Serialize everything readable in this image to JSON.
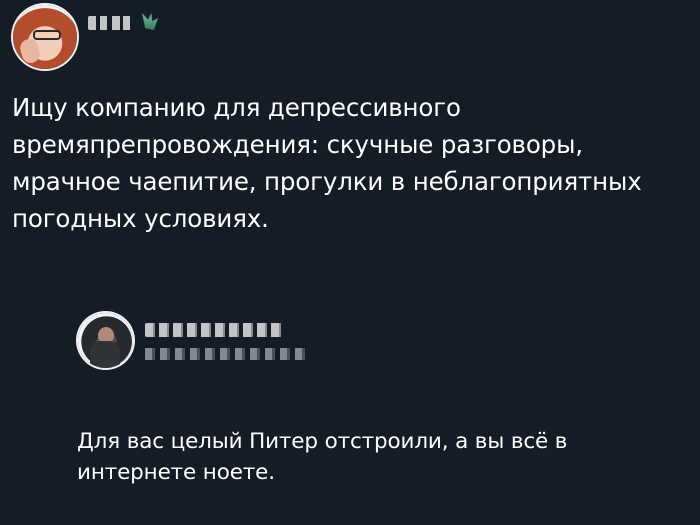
{
  "post": {
    "text": "Ищу компанию для депрессивного времяпрепровождения: скучные разговоры, мрачное чаепитие, прогулки в неблагоприятных погодных условиях."
  },
  "reply": {
    "text": "Для вас целый Питер отстроили, а вы всё в интернете ноете."
  },
  "icons": {
    "author_avatar": "profile-photo",
    "verified_badge": "leaf-badge-icon",
    "reply_avatar": "profile-photo"
  },
  "colors": {
    "background": "#141d26",
    "text": "#ffffff",
    "redacted": "#d8d8d8"
  }
}
